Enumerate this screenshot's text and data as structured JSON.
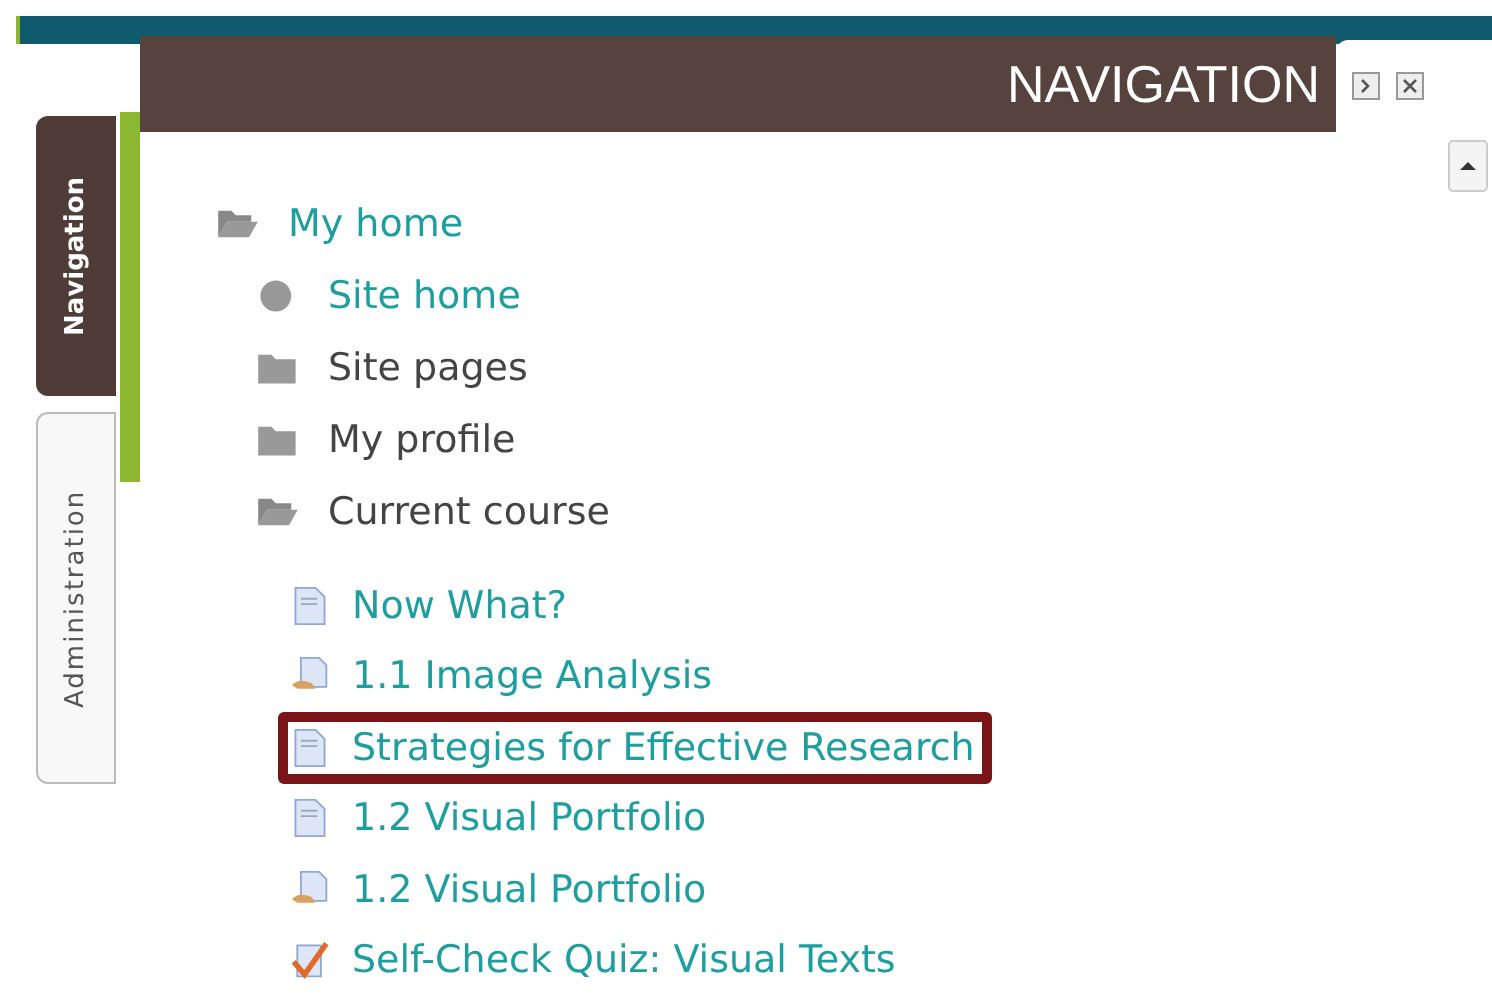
{
  "side_tabs": [
    {
      "label": "Navigation",
      "selected": true
    },
    {
      "label": "Administration",
      "selected": false
    }
  ],
  "block": {
    "title": "NAVIGATION"
  },
  "tree": [
    {
      "label": "My home",
      "kind": "folder-open",
      "link": true,
      "children": [
        {
          "label": "Site home",
          "kind": "dot",
          "link": true
        },
        {
          "label": "Site pages",
          "kind": "folder",
          "link": false
        },
        {
          "label": "My profile",
          "kind": "folder",
          "link": false
        },
        {
          "label": "Current course",
          "kind": "folder-open",
          "link": false,
          "children": [
            {
              "label": "Now What?",
              "kind": "page",
              "link": true,
              "highlighted": false
            },
            {
              "label": "1.1 Image Analysis",
              "kind": "assignment",
              "link": true,
              "highlighted": false
            },
            {
              "label": "Strategies for Effective Research",
              "kind": "page",
              "link": true,
              "highlighted": true
            },
            {
              "label": "1.2 Visual Portfolio",
              "kind": "page",
              "link": true,
              "highlighted": false
            },
            {
              "label": "1.2 Visual Portfolio",
              "kind": "assignment",
              "link": true,
              "highlighted": false
            },
            {
              "label": "Self-Check Quiz: Visual Texts",
              "kind": "quiz",
              "link": true,
              "highlighted": false
            }
          ]
        }
      ]
    }
  ]
}
